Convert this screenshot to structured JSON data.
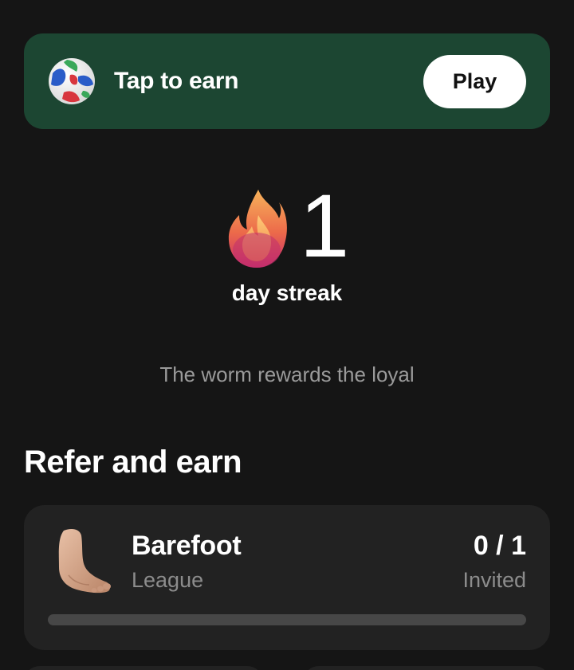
{
  "banner": {
    "icon": "soccer-ball-icon",
    "title": "Tap to earn",
    "button_label": "Play",
    "background": "#1c4632"
  },
  "streak": {
    "icon": "fire-icon",
    "count": "1",
    "label": "day streak",
    "tagline": "The worm rewards the loyal"
  },
  "referral": {
    "section_title": "Refer and earn",
    "league": {
      "icon": "bare-foot-icon",
      "name": "Barefoot",
      "subtitle": "League",
      "invited_count": "0 / 1",
      "invited_label": "Invited",
      "progress": 0
    }
  }
}
